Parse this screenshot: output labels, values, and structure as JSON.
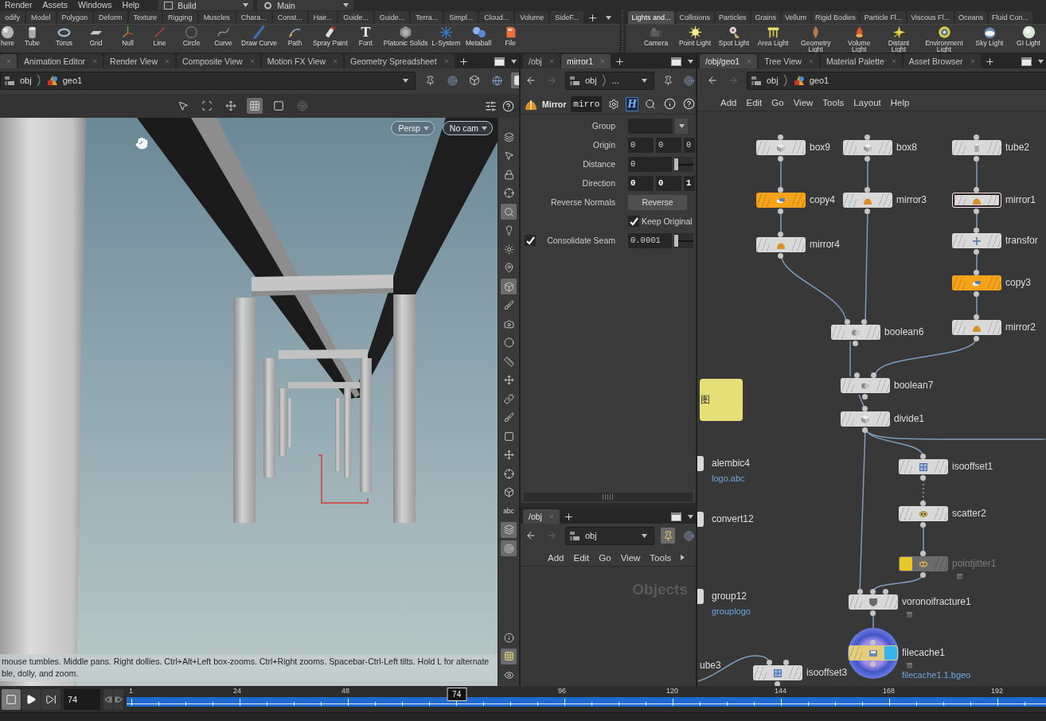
{
  "menu_bar": {
    "items": [
      "Render",
      "Assets",
      "Windows",
      "Help"
    ],
    "desktops": [
      "Build",
      "Main"
    ]
  },
  "shelves": [
    {
      "tabs": [
        {
          "label": "odify",
          "selected": false
        },
        {
          "label": "Model",
          "selected": false
        },
        {
          "label": "Polygon",
          "selected": false
        },
        {
          "label": "Deform",
          "selected": false
        },
        {
          "label": "Texture",
          "selected": false
        },
        {
          "label": "Rigging",
          "selected": false
        },
        {
          "label": "Muscles",
          "selected": false
        },
        {
          "label": "Chara...",
          "selected": false
        },
        {
          "label": "Const...",
          "selected": false
        },
        {
          "label": "Hair...",
          "selected": false
        },
        {
          "label": "Guide...",
          "selected": false
        },
        {
          "label": "Guide...",
          "selected": false
        },
        {
          "label": "Terra...",
          "selected": false
        },
        {
          "label": "Simpl...",
          "selected": false
        },
        {
          "label": "Cloud...",
          "selected": false
        },
        {
          "label": "Volume",
          "selected": false
        },
        {
          "label": "SideF...",
          "selected": false
        }
      ],
      "tools": [
        {
          "label": "here",
          "kind": "sphere"
        },
        {
          "label": "Tube",
          "kind": "tube"
        },
        {
          "label": "Torus",
          "kind": "torus"
        },
        {
          "label": "Grid",
          "kind": "grid"
        },
        {
          "label": "Null",
          "kind": "null"
        },
        {
          "label": "Line",
          "kind": "line"
        },
        {
          "label": "Circle",
          "kind": "circle"
        },
        {
          "label": "Curve",
          "kind": "curve"
        },
        {
          "label": "Draw Curve",
          "kind": "pen"
        },
        {
          "label": "Path",
          "kind": "path"
        },
        {
          "label": "Spray Paint",
          "kind": "spray"
        },
        {
          "label": "Font",
          "kind": "glyph",
          "glyph": "T"
        },
        {
          "label": "Platonic Solids",
          "kind": "platonic"
        },
        {
          "label": "L-System",
          "kind": "lsystem"
        },
        {
          "label": "Metaball",
          "kind": "metaball"
        },
        {
          "label": "File",
          "kind": "file"
        }
      ]
    },
    {
      "tabs": [
        {
          "label": "Lights and...",
          "selected": true
        },
        {
          "label": "Collisions",
          "selected": false
        },
        {
          "label": "Particles",
          "selected": false
        },
        {
          "label": "Grains",
          "selected": false
        },
        {
          "label": "Vellum",
          "selected": false
        },
        {
          "label": "Rigid Bodies",
          "selected": false
        },
        {
          "label": "Particle Fl...",
          "selected": false
        },
        {
          "label": "Viscous Fl...",
          "selected": false
        },
        {
          "label": "Oceans",
          "selected": false
        },
        {
          "label": "Fluid Con...",
          "selected": false
        }
      ],
      "tools": [
        {
          "label": "Camera",
          "kind": "camera"
        },
        {
          "label": "Point Light",
          "kind": "pointlight"
        },
        {
          "label": "Spot Light",
          "kind": "spotlight"
        },
        {
          "label": "Area Light",
          "kind": "arealight"
        },
        {
          "label": "Geometry Light",
          "kind": "geolight"
        },
        {
          "label": "Volume Light",
          "kind": "volumelight"
        },
        {
          "label": "Distant Light",
          "kind": "distantlight"
        },
        {
          "label": "Environment Light",
          "kind": "envlight"
        },
        {
          "label": "Sky Light",
          "kind": "skylight"
        },
        {
          "label": "GI Light",
          "kind": "gilight"
        }
      ]
    }
  ],
  "scene_pane": {
    "tabs": [
      {
        "selected": true
      },
      {
        "label": "Animation Editor",
        "selected": false
      },
      {
        "label": "Render View",
        "selected": false
      },
      {
        "label": "Composite View",
        "selected": false
      },
      {
        "label": "Motion FX View",
        "selected": false
      },
      {
        "label": "Geometry Spreadsheet",
        "selected": false
      }
    ],
    "path": [
      "obj",
      "geo1"
    ],
    "view_tools": [
      {
        "kind": "select",
        "on": false
      },
      {
        "kind": "pointer",
        "on": false
      },
      {
        "kind": "move",
        "on": false
      },
      {
        "kind": "grid",
        "on": true
      },
      {
        "kind": "square",
        "on": false
      },
      {
        "kind": "target",
        "on": false
      }
    ],
    "view_options": [
      {
        "kind": "sliders",
        "on": false
      },
      {
        "kind": "help",
        "on": false
      }
    ],
    "camera_menus": [
      "Persp",
      "No cam"
    ],
    "side_tools": [
      {
        "kind": "view",
        "on": false
      },
      {
        "kind": "select",
        "on": false
      },
      {
        "kind": "lock",
        "on": false
      },
      {
        "kind": "crosshair",
        "on": false
      },
      {
        "kind": "magnifier",
        "on": true
      },
      {
        "kind": "bulb",
        "on": false
      },
      {
        "kind": "sun",
        "on": false
      },
      {
        "kind": "pin",
        "on": false
      },
      {
        "kind": "box",
        "on": true
      },
      {
        "kind": "brush",
        "on": false
      },
      {
        "kind": "camera",
        "on": false
      },
      {
        "kind": "dot",
        "on": false
      },
      {
        "kind": "ruler",
        "on": false
      },
      {
        "kind": "move",
        "on": false
      },
      {
        "kind": "link",
        "on": false
      },
      {
        "kind": "brush",
        "on": false
      },
      {
        "kind": "square",
        "on": false
      },
      {
        "kind": "move",
        "on": false
      },
      {
        "kind": "crosshair",
        "on": false
      },
      {
        "kind": "box",
        "on": false
      },
      {
        "kind": "text",
        "label": "abc",
        "on": false
      },
      {
        "kind": "layers",
        "on": true
      },
      {
        "kind": "target",
        "on": true
      }
    ],
    "side_tools_bottom": [
      {
        "kind": "info",
        "on": false
      },
      {
        "kind": "grid",
        "on": true
      },
      {
        "kind": "eye",
        "on": false
      }
    ],
    "hint_lines": [
      "mouse tumbles. Middle pans. Right dollies. Ctrl+Alt+Left box-zooms. Ctrl+Right zooms. Spacebar-Ctrl-Left tilts. Hold L for alternate",
      "ble, dolly, and zoom."
    ]
  },
  "parameter_pane": {
    "tabs": [
      {
        "label": "/obj",
        "selected": false
      },
      {
        "label": "mirror1",
        "selected": true
      }
    ],
    "path": [
      "obj",
      "..."
    ],
    "node_type": "Mirror",
    "node_name": "mirro",
    "asset_glyph": "H",
    "parameters": [
      {
        "label": "Group",
        "kind": "menu"
      },
      {
        "label": "Origin",
        "kind": "vector",
        "values": [
          "0",
          "0",
          "0"
        ],
        "changed": false
      },
      {
        "label": "Distance",
        "kind": "slider",
        "values": [
          "0"
        ],
        "level": 0
      },
      {
        "label": "Direction",
        "kind": "vector",
        "values": [
          "0",
          "0",
          "1"
        ],
        "changed": true
      },
      {
        "label": "Reverse Normals",
        "kind": "button",
        "button": "Reverse"
      },
      {
        "label": "Keep Original",
        "kind": "toggle",
        "checked": true
      },
      {
        "label": "Consolidate Seam",
        "kind": "toggle_slider",
        "checked": true,
        "values": [
          "0.0001"
        ],
        "level": 0
      }
    ]
  },
  "network_pane": {
    "tabs": [
      {
        "label": "/obj",
        "selected": true
      }
    ],
    "path": [
      "obj"
    ],
    "menu": [
      "Add",
      "Edit",
      "Go",
      "View",
      "Tools"
    ],
    "canvas_label": "Objects"
  },
  "node_editor": {
    "tabs": [
      {
        "label": "/obj/geo1",
        "selected": true
      },
      {
        "label": "Tree View",
        "selected": false
      },
      {
        "label": "Material Palette",
        "selected": false
      },
      {
        "label": "Asset Browser",
        "selected": false
      }
    ],
    "path": [
      "obj",
      "geo1"
    ],
    "menu": [
      "Add",
      "Edit",
      "Go",
      "View",
      "Tools",
      "Layout",
      "Help"
    ],
    "sticky_note": "图",
    "nodes": [
      {
        "name": "box9",
        "kind": "box",
        "color": "#d9d9d9",
        "selected": false,
        "bypassed": false,
        "display": false,
        "badge": false
      },
      {
        "name": "box8",
        "kind": "box",
        "color": "#d9d9d9",
        "selected": false,
        "bypassed": false,
        "display": false,
        "badge": false
      },
      {
        "name": "tube2",
        "kind": "tube",
        "color": "#d9d9d9",
        "selected": false,
        "bypassed": false,
        "display": false,
        "badge": false
      },
      {
        "name": "copy4",
        "kind": "copy",
        "color": "#f5a31a",
        "selected": false,
        "bypassed": false,
        "display": false,
        "badge": false
      },
      {
        "name": "mirror3",
        "kind": "mirror",
        "color": "#d9d9d9",
        "selected": false,
        "bypassed": false,
        "display": false,
        "badge": false
      },
      {
        "name": "mirror1",
        "kind": "mirror",
        "color": "#d9d9d9",
        "selected": true,
        "bypassed": false,
        "display": false,
        "badge": false
      },
      {
        "name": "mirror4",
        "kind": "mirror",
        "color": "#d9d9d9",
        "selected": false,
        "bypassed": false,
        "display": false,
        "badge": false
      },
      {
        "name": "transfor",
        "kind": "transform",
        "color": "#d9d9d9",
        "selected": false,
        "bypassed": false,
        "display": false,
        "badge": false
      },
      {
        "name": "copy3",
        "kind": "copy",
        "color": "#f5a31a",
        "selected": false,
        "bypassed": false,
        "display": false,
        "badge": false
      },
      {
        "name": "boolean6",
        "kind": "boolean",
        "color": "#d9d9d9",
        "selected": false,
        "bypassed": false,
        "display": false,
        "badge": false
      },
      {
        "name": "mirror2",
        "kind": "mirror",
        "color": "#d9d9d9",
        "selected": false,
        "bypassed": false,
        "display": false,
        "badge": false
      },
      {
        "name": "boolean7",
        "kind": "boolean",
        "color": "#d9d9d9",
        "selected": false,
        "bypassed": false,
        "display": false,
        "badge": false
      },
      {
        "name": "divide1",
        "kind": "divide",
        "color": "#d9d9d9",
        "selected": false,
        "bypassed": false,
        "display": false,
        "badge": false
      },
      {
        "name": "isooffset1",
        "kind": "isooffset",
        "color": "#d9d9d9",
        "selected": false,
        "bypassed": false,
        "display": false,
        "badge": false
      },
      {
        "name": "scatter2",
        "kind": "scatter",
        "color": "#d9d9d9",
        "selected": false,
        "bypassed": false,
        "display": false,
        "badge": false
      },
      {
        "name": "pointjitter1",
        "kind": "scatter",
        "color": "#6b6b6b",
        "selected": false,
        "bypassed": true,
        "display": false,
        "badge": true
      },
      {
        "name": "voronoifracture1",
        "kind": "voronoi",
        "color": "#d9d9d9",
        "selected": false,
        "bypassed": false,
        "display": false,
        "badge": true
      },
      {
        "name": "isooffset3",
        "kind": "isooffset",
        "color": "#d9d9d9",
        "selected": false,
        "bypassed": false,
        "display": false,
        "badge": false
      },
      {
        "name": "filecache1",
        "kind": "filecache",
        "color": "#e3cd7e",
        "selected": false,
        "bypassed": false,
        "display": true,
        "badge": true,
        "subtitle": "filecache1.1.bgeo"
      }
    ],
    "edge_nodes": [
      {
        "name": "alembic4",
        "subtitle": "logo.abc"
      },
      {
        "name": "convert12"
      },
      {
        "name": "group12",
        "subtitle": "grouplogo"
      }
    ],
    "offscreen_label": "ube3"
  },
  "timeline": {
    "frame_field": "74",
    "ticks": [
      "1",
      "24",
      "48",
      "96",
      "120",
      "144",
      "168",
      "192"
    ],
    "marker_label": "74",
    "level": 0.359
  }
}
